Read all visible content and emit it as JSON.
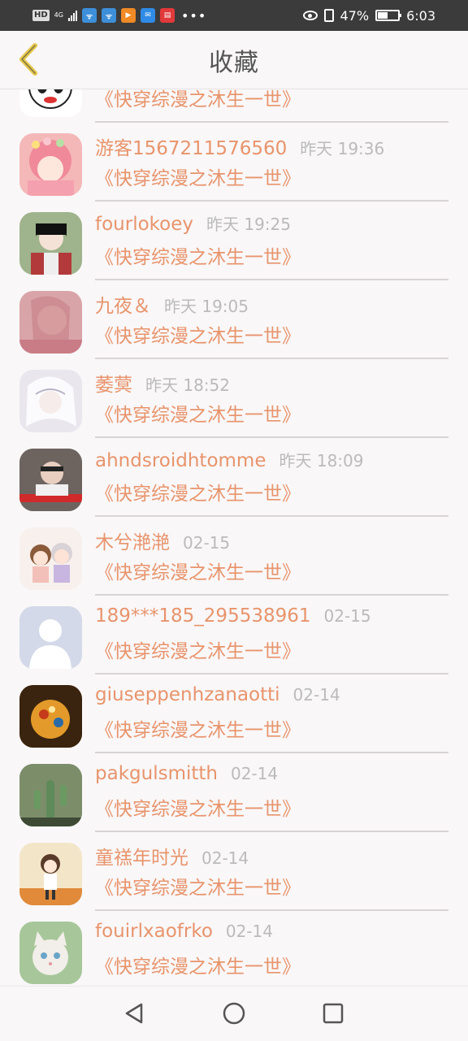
{
  "status_bar": {
    "hd_tag": "HD",
    "network": "4G",
    "battery_percent": "47%",
    "time": "6:03",
    "icons": [
      "signal-icon",
      "wifi-app-icon",
      "wifi-app-icon",
      "video-app-icon",
      "mail-app-icon",
      "news-app-icon",
      "more-dots-icon",
      "eye-icon",
      "vibrate-icon",
      "battery-icon"
    ]
  },
  "header": {
    "title": "收藏",
    "back_icon": "chevron-left-icon",
    "accent_color": "#e6c84b"
  },
  "items": [
    {
      "name": "",
      "time": "",
      "book": "《快穿综漫之沐生一世》",
      "avatar": "panda-avatar",
      "avatar_color": "#ffffff"
    },
    {
      "name": "游客1567211576560",
      "time": "昨天 19:36",
      "book": "《快穿综漫之沐生一世》",
      "avatar": "pink-hair-girl-avatar",
      "avatar_color": "#f4b8b8"
    },
    {
      "name": "fourlokoey",
      "time": "昨天 19:25",
      "book": "《快穿综漫之沐生一世》",
      "avatar": "dark-hair-boy-avatar",
      "avatar_color": "#9fb38c"
    },
    {
      "name": "九夜＆",
      "time": "昨天 19:05",
      "book": "《快穿综漫之沐生一世》",
      "avatar": "pink-portrait-avatar",
      "avatar_color": "#d9a4a8"
    },
    {
      "name": "萎蓂",
      "time": "昨天 18:52",
      "book": "《快穿综漫之沐生一世》",
      "avatar": "white-hair-avatar",
      "avatar_color": "#e9e6ee"
    },
    {
      "name": "ahndsroidhtomme",
      "time": "昨天 18:09",
      "book": "《快穿综漫之沐生一世》",
      "avatar": "photo-woman-avatar",
      "avatar_color": "#8a7f78"
    },
    {
      "name": "木兮滟滟",
      "time": "02-15",
      "book": "《快穿综漫之沐生一世》",
      "avatar": "chibi-pair-avatar",
      "avatar_color": "#f7f0ec"
    },
    {
      "name": "189***185_295538961",
      "time": "02-15",
      "book": "《快穿综漫之沐生一世》",
      "avatar": "default-user-avatar",
      "avatar_color": "#d3d9e8"
    },
    {
      "name": "giuseppenhzanaotti",
      "time": "02-14",
      "book": "《快穿综漫之沐生一世》",
      "avatar": "candle-lantern-avatar",
      "avatar_color": "#c77a1e"
    },
    {
      "name": "pakgulsmitth",
      "time": "02-14",
      "book": "《快穿综漫之沐生一世》",
      "avatar": "cactus-avatar",
      "avatar_color": "#5e7a52"
    },
    {
      "name": "童禚年时光",
      "time": "02-14",
      "book": "《快穿综漫之沐生一世》",
      "avatar": "cartoon-girl-avatar",
      "avatar_color": "#f3e6c8"
    },
    {
      "name": "fouirlxaofrko",
      "time": "02-14",
      "book": "《快穿综漫之沐生一世》",
      "avatar": "cat-avatar",
      "avatar_color": "#a7c79a"
    }
  ],
  "nav": {
    "back_icon": "triangle-back-icon",
    "home_icon": "circle-home-icon",
    "recent_icon": "square-recent-icon"
  }
}
